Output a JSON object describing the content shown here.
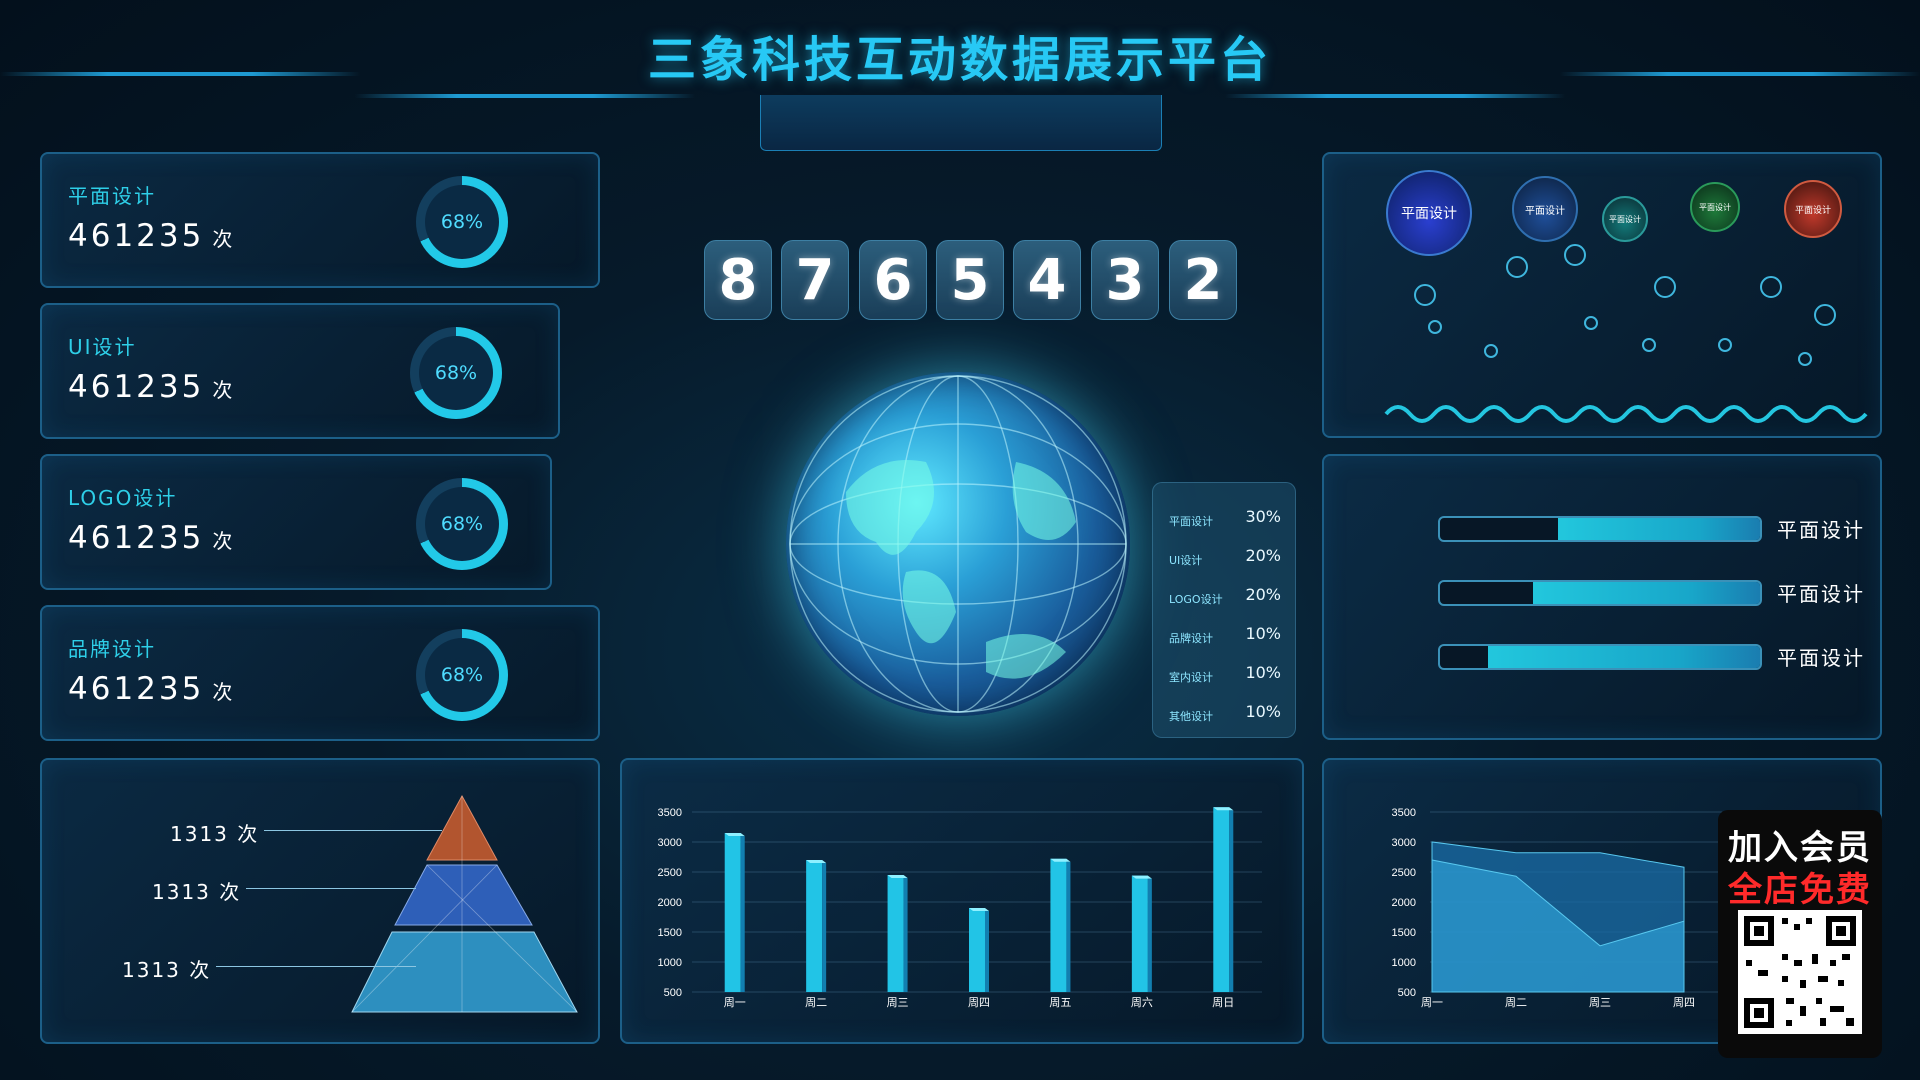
{
  "header": {
    "title": "三象科技互动数据展示平台"
  },
  "stats": [
    {
      "label": "平面设计",
      "value": "461235",
      "unit": "次",
      "percent": "68%"
    },
    {
      "label": "UI设计",
      "value": "461235",
      "unit": "次",
      "percent": "68%"
    },
    {
      "label": "LOGO设计",
      "value": "461235",
      "unit": "次",
      "percent": "68%"
    },
    {
      "label": "品牌设计",
      "value": "461235",
      "unit": "次",
      "percent": "68%"
    }
  ],
  "counter": {
    "digits": [
      "8",
      "7",
      "6",
      "5",
      "4",
      "3",
      "2"
    ]
  },
  "share": [
    {
      "name": "平面设计",
      "value": "30%"
    },
    {
      "name": "UI设计",
      "value": "20%"
    },
    {
      "name": "LOGO设计",
      "value": "20%"
    },
    {
      "name": "品牌设计",
      "value": "10%"
    },
    {
      "name": "室内设计",
      "value": "10%"
    },
    {
      "name": "其他设计",
      "value": "10%"
    }
  ],
  "bubbles": [
    {
      "label": "平面设计",
      "color": "#2a3fd0"
    },
    {
      "label": "平面设计",
      "color": "#1f4f9a"
    },
    {
      "label": "平面设计",
      "color": "#137a7a"
    },
    {
      "label": "平面设计",
      "color": "#1e7a3a"
    },
    {
      "label": "平面设计",
      "color": "#c0392b"
    }
  ],
  "progress": [
    {
      "label": "平面设计",
      "fill": 0.63
    },
    {
      "label": "平面设计",
      "fill": 0.71
    },
    {
      "label": "平面设计",
      "fill": 0.85
    }
  ],
  "pyramid": {
    "labels": [
      "1313 次",
      "1313 次",
      "1313 次"
    ]
  },
  "chart_data": [
    {
      "type": "bar",
      "categories": [
        "周一",
        "周二",
        "周三",
        "周四",
        "周五",
        "周六",
        "周日"
      ],
      "values": [
        3150,
        2700,
        2450,
        1900,
        2720,
        2440,
        3580
      ],
      "yticks": [
        "3500",
        "3000",
        "2500",
        "2000",
        "1500",
        "1000",
        "500"
      ],
      "ylim": [
        500,
        3500
      ]
    },
    {
      "type": "area",
      "categories": [
        "周一",
        "周二",
        "周三",
        "周四"
      ],
      "series": [
        {
          "values": [
            3000,
            2820,
            2820,
            2580
          ]
        },
        {
          "values": [
            2700,
            2430,
            1270,
            1680
          ]
        }
      ],
      "yticks": [
        "3500",
        "3000",
        "2500",
        "2000",
        "1500",
        "1000",
        "500"
      ],
      "ylim": [
        500,
        3500
      ]
    }
  ],
  "promo": {
    "line1": "加入会员",
    "line2": "全店免费"
  }
}
